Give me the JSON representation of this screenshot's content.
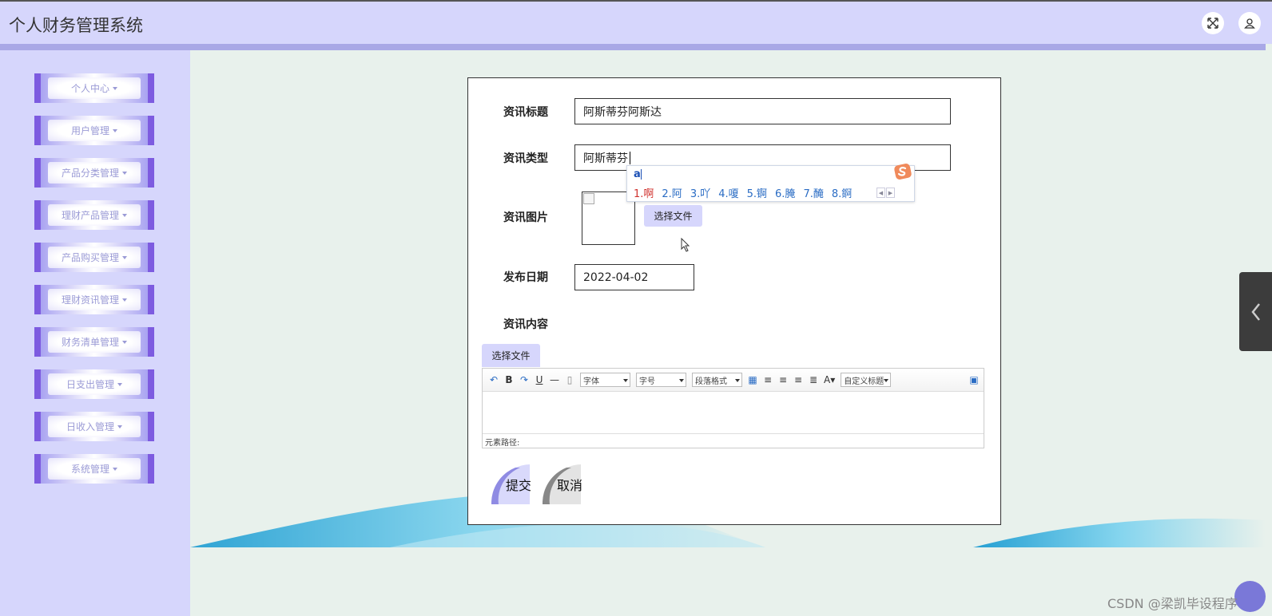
{
  "header": {
    "title": "个人财务管理系统",
    "fullscreen_icon": "fullscreen-icon",
    "user_icon": "user-icon"
  },
  "sidebar": {
    "items": [
      {
        "label": "个人中心"
      },
      {
        "label": "用户管理"
      },
      {
        "label": "产品分类管理"
      },
      {
        "label": "理财产品管理"
      },
      {
        "label": "产品购买管理"
      },
      {
        "label": "理财资讯管理"
      },
      {
        "label": "财务清单管理"
      },
      {
        "label": "日支出管理"
      },
      {
        "label": "日收入管理"
      },
      {
        "label": "系统管理"
      }
    ]
  },
  "form": {
    "title_label": "资讯标题",
    "title_value": "阿斯蒂芬阿斯达",
    "type_label": "资讯类型",
    "type_value": "阿斯蒂芬",
    "image_label": "资讯图片",
    "choose_file": "选择文件",
    "date_label": "发布日期",
    "date_value": "2022-04-02",
    "content_label": "资讯内容",
    "editor_choose_file": "选择文件",
    "submit": "提交",
    "cancel": "取消"
  },
  "ime": {
    "input": "a",
    "candidates": [
      "1.啊",
      "2.阿",
      "3.吖",
      "4.嗄",
      "5.锕",
      "6.腌",
      "7.醃",
      "8.錒"
    ]
  },
  "editor": {
    "font_combo": "字体",
    "size_combo": "字号",
    "paragraph_combo": "段落格式",
    "custom_title_combo": "自定义标题",
    "status_path": "元素路径:"
  },
  "watermark": "CSDN @梁凯毕设程序",
  "colors": {
    "accent": "#d6d6fc",
    "sidebar_purple": "#7d5be0",
    "background": "#e8f1ec"
  }
}
